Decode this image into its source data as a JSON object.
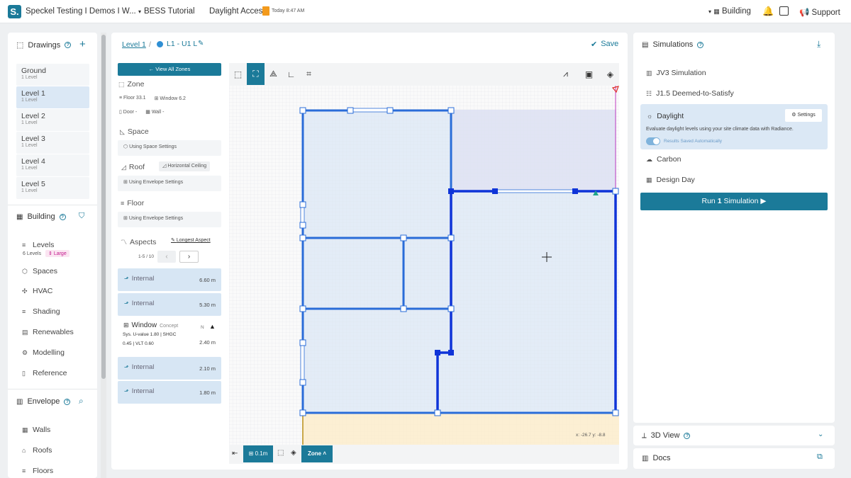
{
  "header": {
    "logo_letter": "S.",
    "project": "Speckel Testing I Demos I W...",
    "tab2": "BESS Tutorial",
    "tab3": "Daylight Access",
    "timestamp": "Today 8:47 AM",
    "building_label": "Building",
    "support_label": "Support"
  },
  "left": {
    "drawings_title": "Drawings",
    "levels": [
      {
        "name": "Ground",
        "sub": "1 Level"
      },
      {
        "name": "Level 1",
        "sub": "1 Level"
      },
      {
        "name": "Level 2",
        "sub": "1 Level"
      },
      {
        "name": "Level 3",
        "sub": "1 Level"
      },
      {
        "name": "Level 4",
        "sub": "1 Level"
      },
      {
        "name": "Level 5",
        "sub": "1 Level"
      }
    ],
    "building_title": "Building",
    "building_items": [
      "Levels",
      "Spaces",
      "HVAC",
      "Shading",
      "Renewables",
      "Modelling",
      "Reference"
    ],
    "levels_sub": "6 Levels",
    "levels_badge": "Large",
    "envelope_title": "Envelope",
    "envelope_items": [
      "Walls",
      "Roofs",
      "Floors"
    ]
  },
  "crumb": {
    "level": "Level 1",
    "zone": "L1 - U1 L",
    "save": "Save"
  },
  "zone_panel": {
    "view_all": "View All Zones",
    "zone_title": "Zone",
    "floor": "Floor 33.1",
    "window": "Window 6.2",
    "door": "Door -",
    "wall": "Wall -",
    "space_title": "Space",
    "space_setting": "Using Space Settings",
    "roof_title": "Roof",
    "roof_badge": "Horizontal Ceiling",
    "roof_setting": "Using Envelope Settings",
    "floor_title": "Floor",
    "floor_setting": "Using Envelope Settings",
    "aspects_title": "Aspects",
    "aspects_link": "Longest Aspect",
    "pager": "1-5 / 10",
    "aspects": [
      {
        "label": "Internal",
        "value": "6.60 m"
      },
      {
        "label": "Internal",
        "value": "5.30 m"
      },
      {
        "label": "Window",
        "tag": "Concept",
        "details1": "Sys. U-value 1.80 | SHGC",
        "details2": "0.45 | VLT 0.60",
        "compass": "N",
        "value": "2.40 m"
      },
      {
        "label": "Internal",
        "value": "2.10 m"
      },
      {
        "label": "Internal",
        "value": "1.80 m"
      }
    ]
  },
  "canvas": {
    "coords": "x: -26.7  y: -8.8",
    "grid_label": "0.1m",
    "mode_label": "Zone"
  },
  "sims": {
    "title": "Simulations",
    "items": [
      "JV3 Simulation",
      "J1.5 Deemed-to-Satisfy"
    ],
    "daylight_title": "Daylight",
    "daylight_settings": "Settings",
    "daylight_desc": "Evaluate daylight levels using your site climate data with Radiance.",
    "daylight_toggle": "Results Saved Automatically",
    "items2": [
      "Carbon",
      "Design Day"
    ],
    "run_label_pre": "Run",
    "run_label_num": "1",
    "run_label_post": "Simulation",
    "view3d": "3D View",
    "docs": "Docs"
  },
  "colors": {
    "accent": "#1b7a99",
    "wall_blue": "#1d5fe0",
    "zone_fill": "#dde9f6",
    "pink_fill": "#ecc6e6",
    "yellow_fill": "#fbeccb"
  }
}
